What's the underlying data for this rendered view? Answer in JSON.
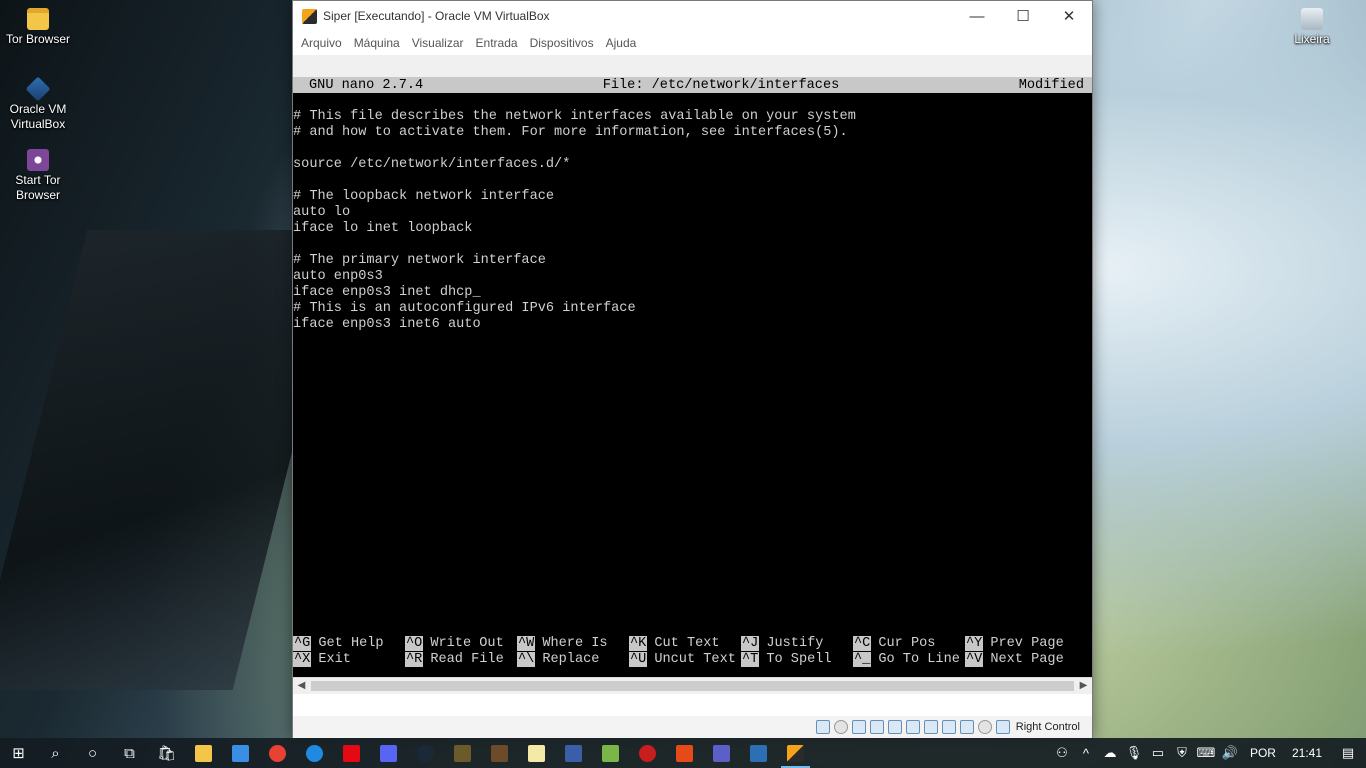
{
  "desktop": {
    "icons": [
      {
        "label": "Tor Browser",
        "icon": "folder-icon"
      },
      {
        "label": "Oracle VM VirtualBox",
        "icon": "virtualbox-icon"
      },
      {
        "label": "Start Tor Browser",
        "icon": "tor-icon"
      },
      {
        "label": "Lixeira",
        "icon": "recycle-bin-icon"
      }
    ]
  },
  "window": {
    "title": "Siper [Executando] - Oracle VM VirtualBox",
    "controls": {
      "minimize": "—",
      "maximize": "☐",
      "close": "✕"
    },
    "menu": [
      "Arquivo",
      "Máquina",
      "Visualizar",
      "Entrada",
      "Dispositivos",
      "Ajuda"
    ]
  },
  "nano": {
    "version": "GNU nano 2.7.4",
    "file": "File: /etc/network/interfaces",
    "status": "Modified",
    "lines": [
      "# This file describes the network interfaces available on your system",
      "# and how to activate them. For more information, see interfaces(5).",
      "",
      "source /etc/network/interfaces.d/*",
      "",
      "# The loopback network interface",
      "auto lo",
      "iface lo inet loopback",
      "",
      "# The primary network interface",
      "auto enp0s3",
      "iface enp0s3 inet dhcp_",
      "# This is an autoconfigured IPv6 interface",
      "iface enp0s3 inet6 auto"
    ],
    "shortcuts": [
      [
        {
          "key": "^G",
          "label": "Get Help"
        },
        {
          "key": "^X",
          "label": "Exit"
        }
      ],
      [
        {
          "key": "^O",
          "label": "Write Out"
        },
        {
          "key": "^R",
          "label": "Read File"
        }
      ],
      [
        {
          "key": "^W",
          "label": "Where Is"
        },
        {
          "key": "^\\",
          "label": "Replace"
        }
      ],
      [
        {
          "key": "^K",
          "label": "Cut Text"
        },
        {
          "key": "^U",
          "label": "Uncut Text"
        }
      ],
      [
        {
          "key": "^J",
          "label": "Justify"
        },
        {
          "key": "^T",
          "label": "To Spell"
        }
      ],
      [
        {
          "key": "^C",
          "label": "Cur Pos"
        },
        {
          "key": "^_",
          "label": "Go To Line"
        }
      ],
      [
        {
          "key": "^Y",
          "label": "Prev Page"
        },
        {
          "key": "^V",
          "label": "Next Page"
        }
      ]
    ]
  },
  "statusbar": {
    "host_key": "Right Control",
    "icons": [
      "hard-disk-icon",
      "optical-drive-icon",
      "audio-icon",
      "network-icon",
      "usb-icon",
      "shared-folders-icon",
      "display-icon",
      "recording-icon",
      "cpu-icon",
      "mouse-integration-icon",
      "keyboard-icon"
    ]
  },
  "taskbar": {
    "apps": [
      {
        "name": "file-explorer",
        "color": "#f3c64a"
      },
      {
        "name": "mail",
        "color": "#3a8ee6"
      },
      {
        "name": "chrome",
        "color": "#e94235"
      },
      {
        "name": "edge",
        "color": "#1e8ae0"
      },
      {
        "name": "netflix",
        "color": "#e50914"
      },
      {
        "name": "discord",
        "color": "#5865f2"
      },
      {
        "name": "steam",
        "color": "#1b2838"
      },
      {
        "name": "game-app",
        "color": "#6b5a2a"
      },
      {
        "name": "minecraft",
        "color": "#6d4a2a"
      },
      {
        "name": "notepad",
        "color": "#f5e9a8"
      },
      {
        "name": "calculator-app",
        "color": "#3a5ea8"
      },
      {
        "name": "utility-app",
        "color": "#7ab648"
      },
      {
        "name": "media-app",
        "color": "#c81e1e"
      },
      {
        "name": "office",
        "color": "#e64a19"
      },
      {
        "name": "teams",
        "color": "#5b5fc7"
      },
      {
        "name": "virtualbox",
        "color": "#2d6fb4"
      },
      {
        "name": "virtualbox-vm",
        "color": "#f7a21b",
        "active": true
      }
    ],
    "tray": {
      "language": "POR",
      "time": "21:41"
    }
  }
}
